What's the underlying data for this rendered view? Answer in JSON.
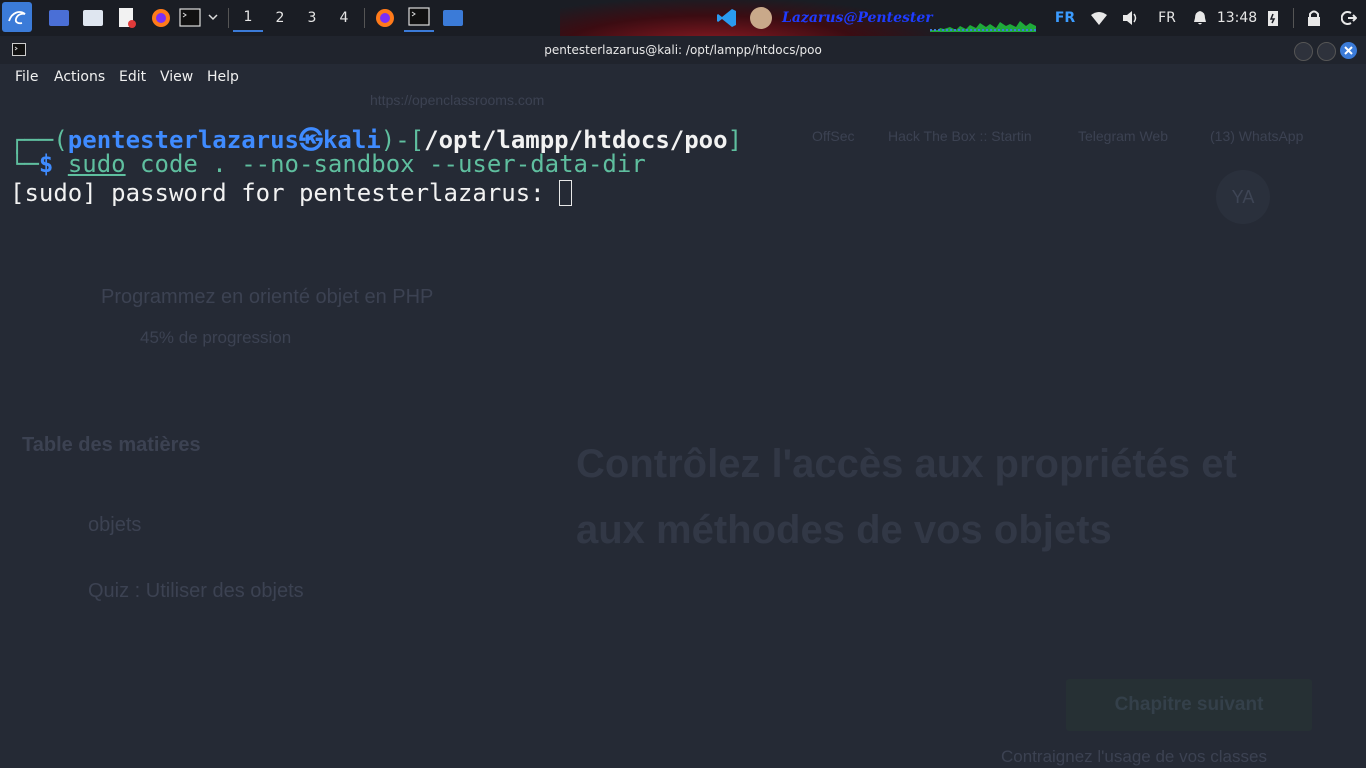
{
  "panel": {
    "workspaces": [
      "1",
      "2",
      "3",
      "4"
    ],
    "user_label": "Lazarus@Pentester",
    "keyboard_layout": "FR",
    "locale": "FR",
    "clock": "13:48"
  },
  "window": {
    "title": "pentesterlazarus@kali: /opt/lampp/htdocs/poo"
  },
  "menu": [
    "File",
    "Actions",
    "Edit",
    "View",
    "Help"
  ],
  "prompt": {
    "open": "┌──(",
    "user_host": "pentesterlazarus㉿kali",
    "mid": ")-[",
    "cwd": "/opt/lampp/htdocs/poo",
    "close": "]",
    "line2_prefix": "└─",
    "dollar": "$ ",
    "cmd_sudo": "sudo",
    "cmd_rest": " code . --no-sandbox --user-data-dir"
  },
  "output": {
    "sudo_prompt": "[sudo] password for pentesterlazarus: "
  },
  "background": {
    "url": "https://openclassrooms.com",
    "course_title": "Programmez en orienté objet en PHP",
    "progress_label": "45% de progression",
    "toc_title": "Table des matières",
    "toc_item_1": "objets",
    "toc_item_2": "Quiz : Utiliser des objets",
    "heading_line1": "Contrôlez l'accès aux propriétés et",
    "heading_line2": "aux méthodes de vos objets",
    "next_button": "Chapitre suivant",
    "next_caption": "Contraignez l'usage de vos classes",
    "avatar": "YA",
    "tabs": [
      "OffSec",
      "Hack The Box :: Startin",
      "Telegram Web",
      "(13) WhatsApp"
    ]
  },
  "colors": {
    "accent": "#3b7bd8",
    "prompt_blue": "#3f8bff",
    "prompt_green": "#5fbf9f",
    "close_button": "#3b7bd8"
  }
}
